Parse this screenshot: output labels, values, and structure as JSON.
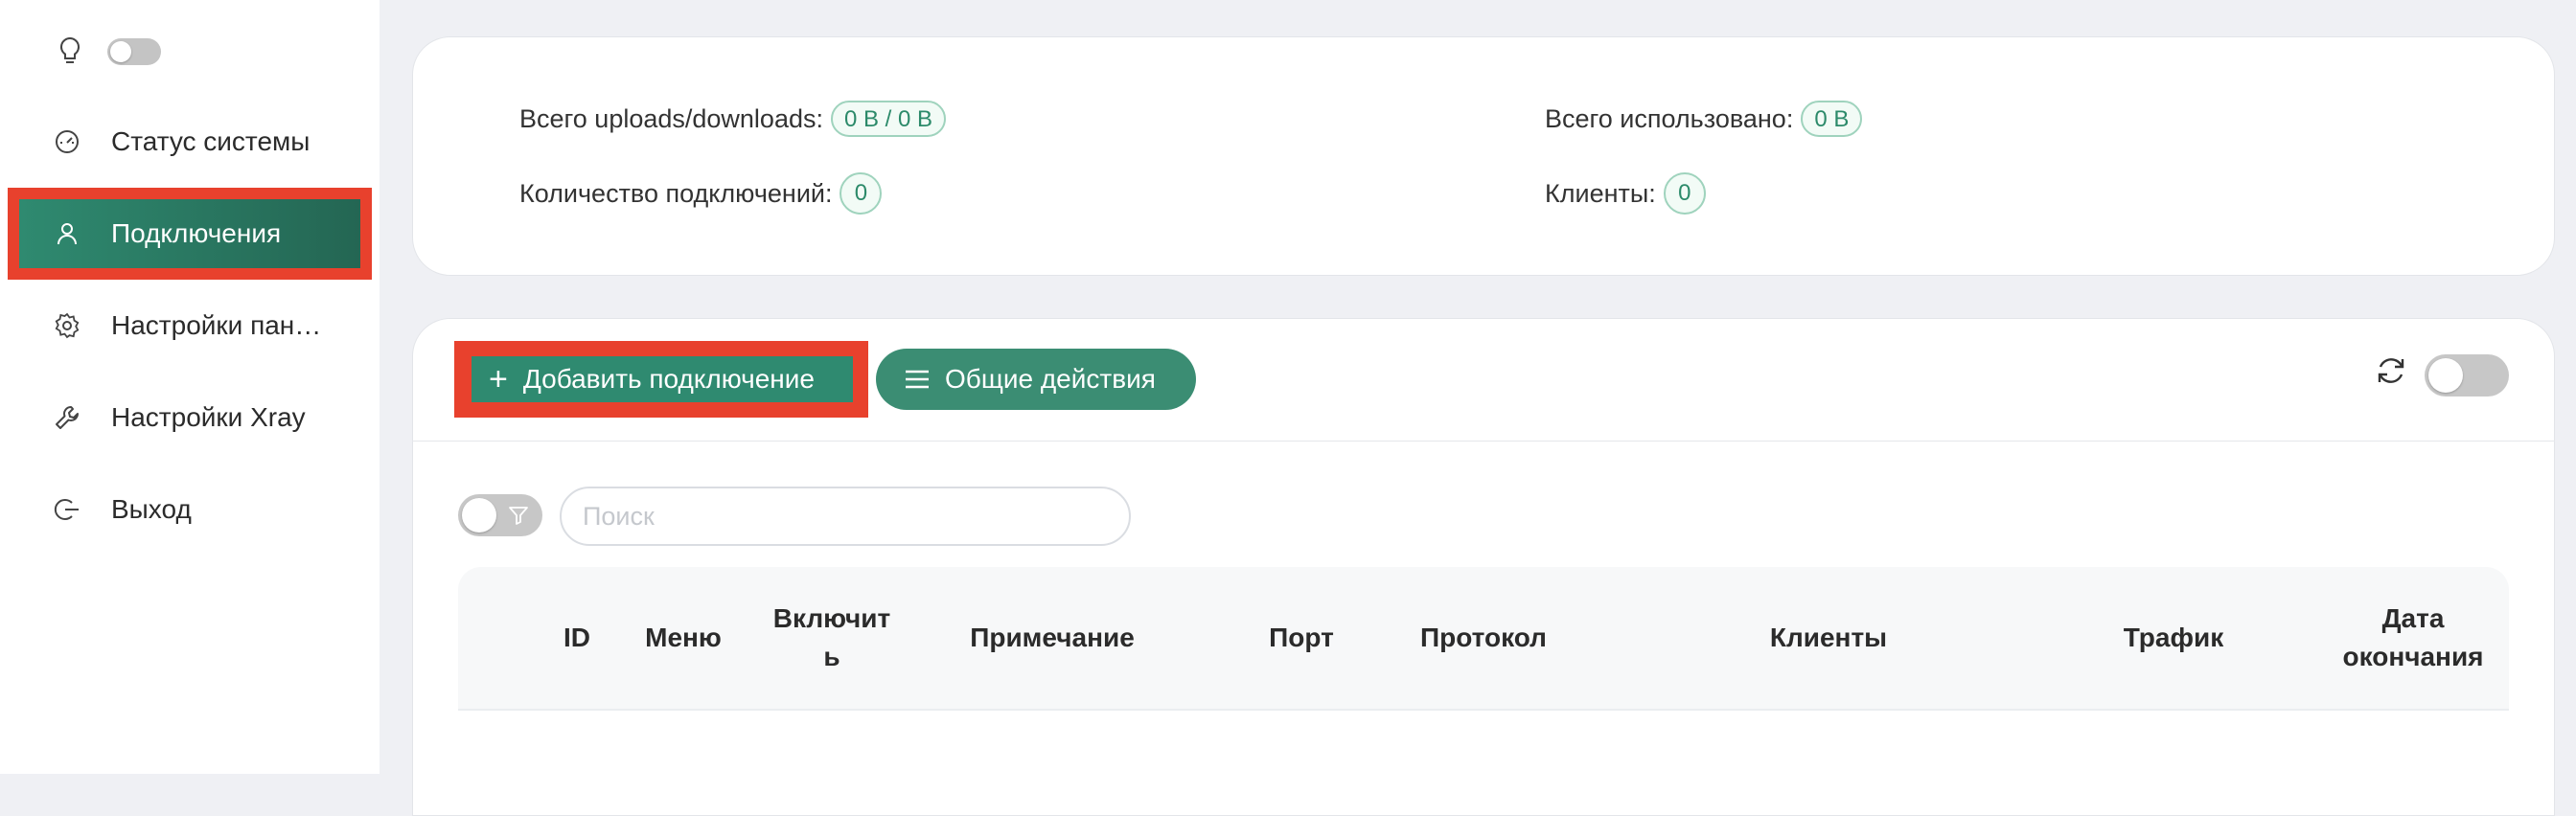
{
  "sidebar": {
    "items": [
      {
        "label": "Статус системы",
        "icon": "dashboard-icon"
      },
      {
        "label": "Подключения",
        "icon": "user-icon",
        "active": true
      },
      {
        "label": "Настройки пан…",
        "icon": "gear-icon"
      },
      {
        "label": "Настройки Xray",
        "icon": "wrench-icon"
      },
      {
        "label": "Выход",
        "icon": "logout-icon"
      }
    ]
  },
  "stats": {
    "total_updown_label": "Всего uploads/downloads:",
    "total_updown_value": "0 B / 0 B",
    "total_used_label": "Всего использовано:",
    "total_used_value": "0 B",
    "connections_label": "Количество подключений:",
    "connections_value": "0",
    "clients_label": "Клиенты:",
    "clients_value": "0"
  },
  "toolbar": {
    "add_label": "Добавить подключение",
    "general_label": "Общие действия"
  },
  "search": {
    "placeholder": "Поиск"
  },
  "table": {
    "columns": [
      "ID",
      "Меню",
      "Включит\nь",
      "Примечание",
      "Порт",
      "Протокол",
      "Клиенты",
      "Трафик",
      "Дата\nокончания"
    ]
  },
  "colors": {
    "accent": "#2f8a70",
    "highlight": "#e8412d",
    "pill_text": "#2c8a6a"
  }
}
